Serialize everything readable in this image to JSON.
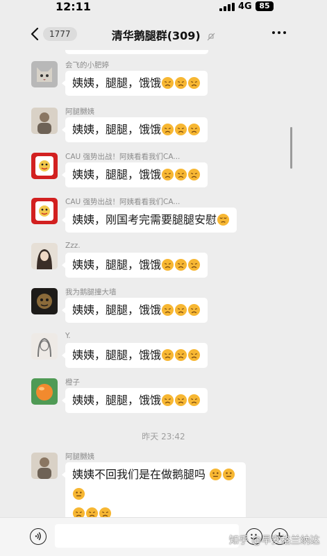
{
  "status_bar": {
    "time": "12:11",
    "network": "4G",
    "battery": "85"
  },
  "header": {
    "back_count": "1777",
    "title": "清华鹅腿群(309)"
  },
  "messages": [
    {
      "sender": "会飞的小肥婷",
      "text": "姨姨，腿腿，饿饿",
      "emoji_count": 3,
      "avatar": "cat"
    },
    {
      "sender": "阿腿嬲姨",
      "text": "姨姨，腿腿，饿饿",
      "emoji_count": 3,
      "avatar": "person"
    },
    {
      "sender": "CAU 强势出战！阿姨看看我们CA...",
      "text": "姨姨，腿腿，饿饿",
      "emoji_count": 3,
      "avatar": "red-logo"
    },
    {
      "sender": "CAU 强势出战！阿姨看看我们CA...",
      "text": "姨姨，刚国考完需要腿腿安慰",
      "emoji_count": 1,
      "avatar": "red-logo"
    },
    {
      "sender": "Zzz.",
      "text": "姨姨，腿腿，饿饿",
      "emoji_count": 3,
      "avatar": "girl"
    },
    {
      "sender": "我为鹅腿撞大墙",
      "text": "姨姨，腿腿，饿饿",
      "emoji_count": 3,
      "avatar": "dark"
    },
    {
      "sender": "Y.",
      "text": "姨姨，腿腿，饿饿",
      "emoji_count": 3,
      "avatar": "sketch"
    },
    {
      "sender": "橙子",
      "text": "姨姨，腿腿，饿饿",
      "emoji_count": 3,
      "avatar": "orange"
    }
  ],
  "timestamp": "昨天 23:42",
  "last_message": {
    "sender": "阿腿嬲姨",
    "text": "姨姨不回我们是在做鹅腿吗",
    "avatar": "person"
  },
  "watermark": "知乎 @早安格兰纳达",
  "colors": {
    "background": "#ededed",
    "bubble": "#ffffff",
    "emoji": "#f7b733"
  }
}
